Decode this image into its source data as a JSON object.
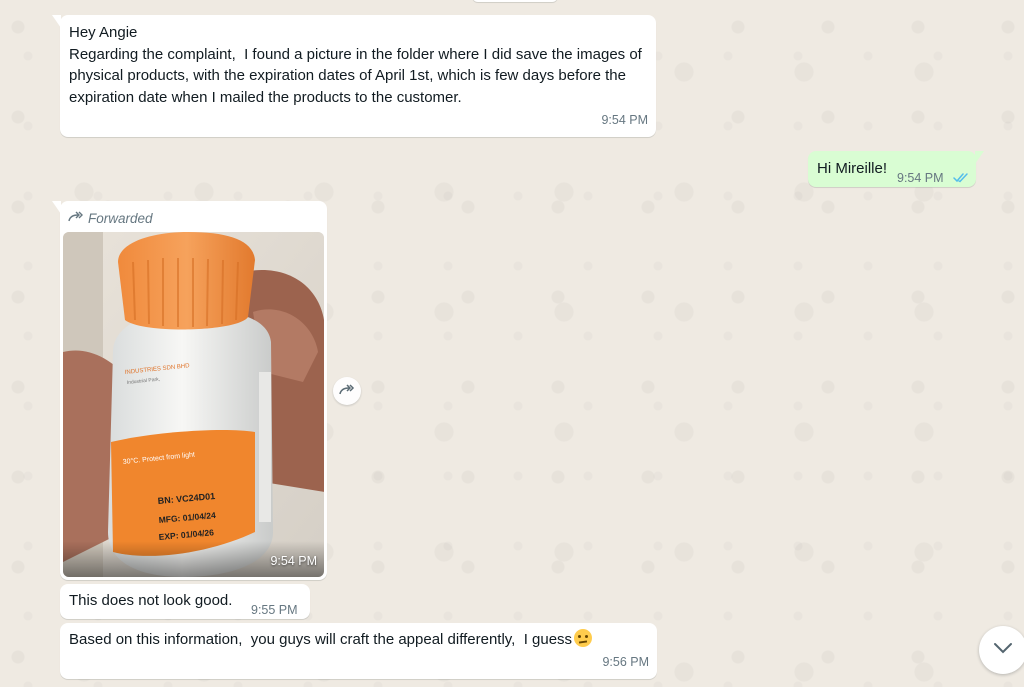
{
  "chat": {
    "messages": [
      {
        "direction": "incoming",
        "text": "Hey Angie\nRegarding the complaint,  I found a picture in the folder where I did save the images of physical products, with the expiration dates of April 1st, which is few days before the expiration date when I mailed the products to the customer.",
        "time": "9:54 PM"
      },
      {
        "direction": "outgoing",
        "text": "Hi Mireille!",
        "time": "9:54 PM",
        "status_icon": "double-check-read-icon"
      },
      {
        "direction": "incoming",
        "forwarded_label": "Forwarded",
        "type": "image",
        "image_text": {
          "company": "INDUSTRIES SDN BHD",
          "address_line": "Industrial Park,",
          "storage": "30°C. Protect from light",
          "bn": "BN: VC24D01",
          "mfg": "MFG: 01/04/24",
          "exp": "EXP: 01/04/26"
        },
        "time": "9:54 PM"
      },
      {
        "direction": "incoming",
        "text": "This does not look good.",
        "time": "9:55 PM"
      },
      {
        "direction": "incoming",
        "text": "Based on this information,  you guys will craft the appeal differently,  I guess",
        "emoji": "thinking-face",
        "time": "9:56 PM"
      }
    ]
  },
  "colors": {
    "chat_background": "#efeae2",
    "incoming_bubble": "#ffffff",
    "outgoing_bubble": "#d9fdd3",
    "timestamp": "#667781",
    "read_ticks": "#53bdeb"
  },
  "icons": {
    "forward": "forward-icon",
    "forwarded_label": "forwarded-arrow-icon",
    "scroll_down": "chevron-down-icon"
  }
}
